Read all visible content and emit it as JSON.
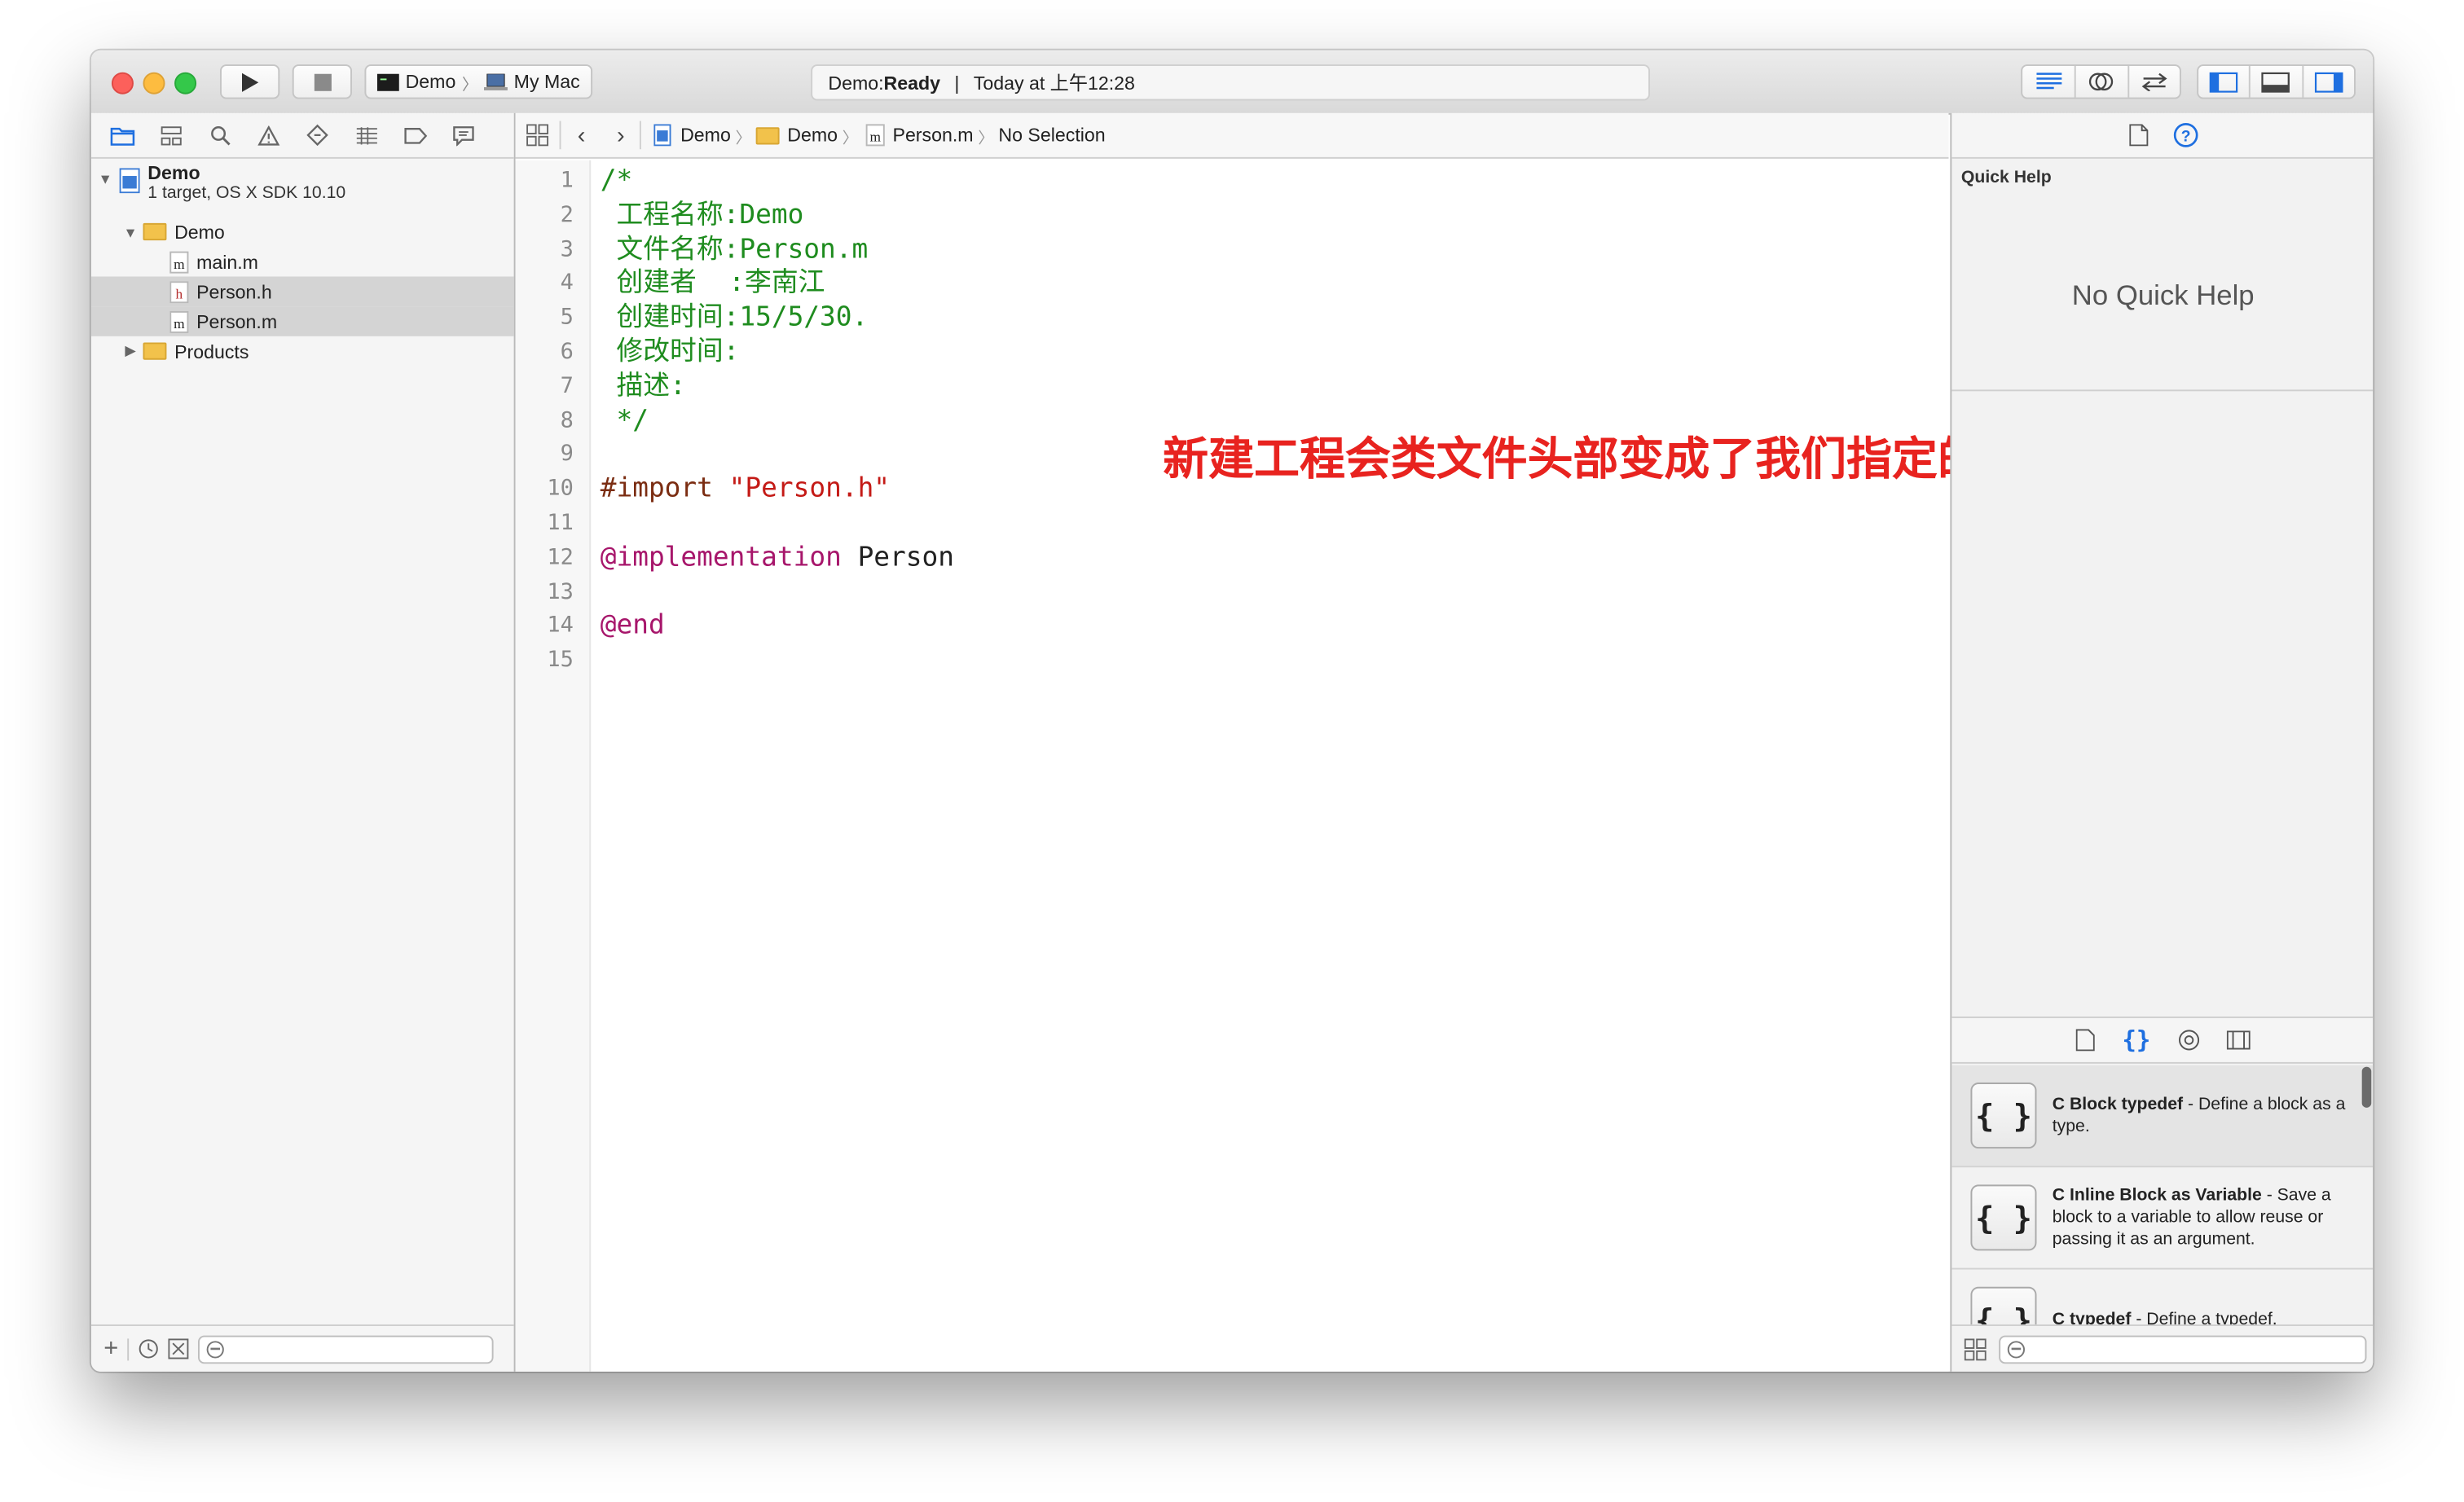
{
  "toolbar": {
    "scheme_target": "Demo",
    "scheme_destination": "My Mac",
    "activity_project": "Demo: ",
    "activity_state": "Ready",
    "activity_separator": "|",
    "activity_time": "Today at 上午12:28"
  },
  "navigator": {
    "project": {
      "name": "Demo",
      "subtitle": "1 target, OS X SDK 10.10"
    },
    "items": [
      {
        "label": "Demo",
        "kind": "group"
      },
      {
        "label": "main.m",
        "kind": "m"
      },
      {
        "label": "Person.h",
        "kind": "h"
      },
      {
        "label": "Person.m",
        "kind": "m"
      },
      {
        "label": "Products",
        "kind": "group"
      }
    ]
  },
  "jumpbar": {
    "crumbs": [
      "Demo",
      "Demo",
      "Person.m",
      "No Selection"
    ]
  },
  "editor": {
    "line_numbers": [
      "1",
      "2",
      "3",
      "4",
      "5",
      "6",
      "7",
      "8",
      "9",
      "10",
      "11",
      "12",
      "13",
      "14",
      "15"
    ],
    "lines": [
      {
        "t": "/*",
        "c": "cm"
      },
      {
        "t": " 工程名称:Demo",
        "c": "cm"
      },
      {
        "t": " 文件名称:Person.m",
        "c": "cm"
      },
      {
        "t": " 创建者  :李南江",
        "c": "cm"
      },
      {
        "t": " 创建时间:15/5/30.",
        "c": "cm"
      },
      {
        "t": " 修改时间:",
        "c": "cm"
      },
      {
        "t": " 描述:",
        "c": "cm"
      },
      {
        "t": " */",
        "c": "cm"
      },
      {
        "t": "",
        "c": ""
      },
      {
        "t": "#import ",
        "c": "pp"
      },
      {
        "t": "",
        "c": ""
      },
      {
        "t": "@implementation",
        "c": "kw"
      },
      {
        "t": "",
        "c": ""
      },
      {
        "t": "@end",
        "c": "kw"
      },
      {
        "t": "",
        "c": ""
      }
    ],
    "import_string": "\"Person.h\"",
    "class_name": " Person",
    "annotation": "新建工程会类文件头部变成了我们指定的格式"
  },
  "inspector": {
    "quick_help_title": "Quick Help",
    "quick_help_empty": "No Quick Help",
    "snippets": [
      {
        "icon": "{ }",
        "title": "C Block typedef",
        "desc": " - Define a block as a type."
      },
      {
        "icon": "{ }",
        "title": "C Inline Block as Variable",
        "desc": " - Save a block to a variable to allow reuse or passing it as an argument."
      },
      {
        "icon": "{ }",
        "title": "C typedef",
        "desc": " - Define a typedef."
      }
    ]
  },
  "colors": {
    "comment": "#1f8c1f",
    "keyword": "#a7166b",
    "string": "#c41a16",
    "preprocessor": "#7b2d12",
    "annotation": "#e8231f",
    "accent": "#1e6fe0"
  }
}
